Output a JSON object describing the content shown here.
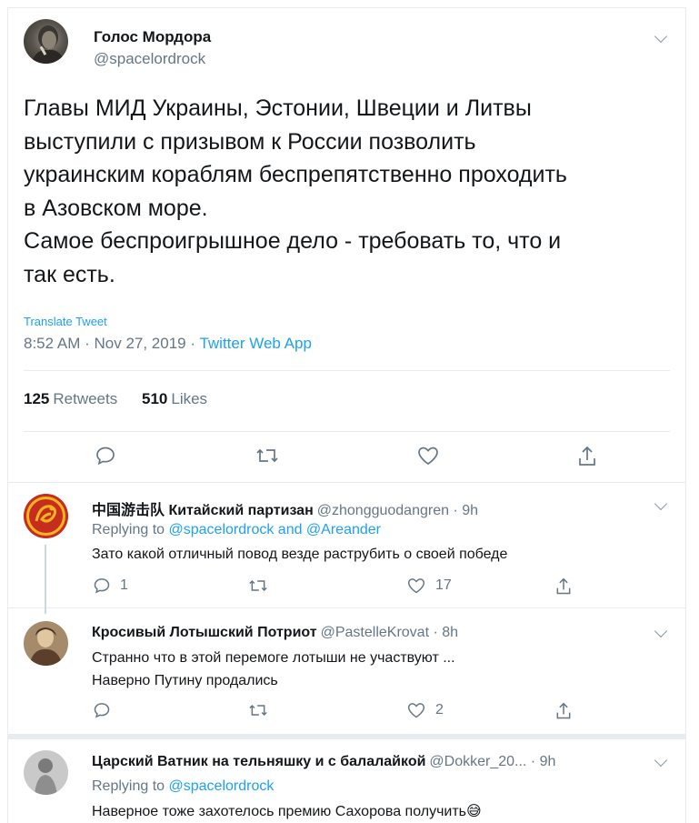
{
  "main": {
    "author_name": "Голос Мордора",
    "author_handle": "@spacelordrock",
    "text": "Главы МИД Украины, Эстонии, Швеции и Литвы\nвыступили с призывом к России позволить\nукраинским кораблям беспрепятственно проходить\nв Азовском море.\nСамое беспроигрышное дело - требовать то, что и\nтак есть.",
    "translate_label": "Translate Tweet",
    "time": "8:52 AM",
    "date": "Nov 27, 2019",
    "app": "Twitter Web App",
    "retweets_count": "125",
    "retweets_label": "Retweets",
    "likes_count": "510",
    "likes_label": "Likes"
  },
  "replies": [
    {
      "name": "中国游击队 Китайский партизан",
      "handle": "@zhongguodangren · 9h",
      "replying_prefix": "Replying to",
      "replying_to": "@spacelordrock and @Areander",
      "text": "Зато какой отличный повод везде раструбить о своей победе",
      "reply_count": "1",
      "retweet_count": "",
      "like_count": "17"
    },
    {
      "name": "Кросивый Лотышский Потриот",
      "handle": "@PastelleKrovat · 8h",
      "text": "Странно что в этой перемоге лотыши не участвуют ...\nНаверно Путину продались",
      "reply_count": "",
      "retweet_count": "",
      "like_count": "2"
    },
    {
      "name": "Царский Ватник на тельняшку и с балалайкой",
      "handle": "@Dokker_20... · 9h",
      "replying_prefix": "Replying to",
      "replying_to": "@spacelordrock",
      "text": "Наверное тоже захотелось премию Сахорова получить😅"
    }
  ],
  "colors": {
    "accent": "#1da1f2",
    "secondary_text": "#657786",
    "border": "#e6ecf0"
  },
  "icons": [
    "reply-icon",
    "retweet-icon",
    "like-icon",
    "share-icon",
    "chevron-down-icon"
  ]
}
